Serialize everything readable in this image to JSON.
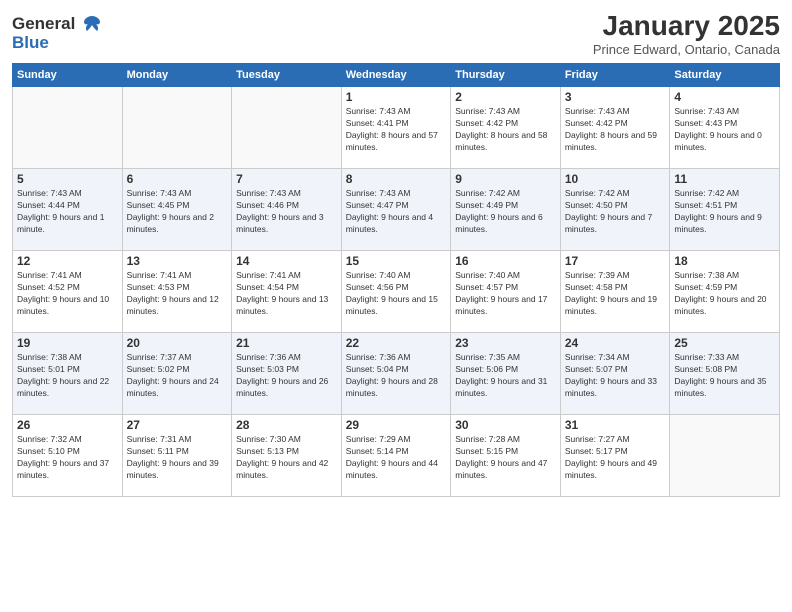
{
  "header": {
    "logo_line1": "General",
    "logo_line2": "Blue",
    "title": "January 2025",
    "location": "Prince Edward, Ontario, Canada"
  },
  "days_of_week": [
    "Sunday",
    "Monday",
    "Tuesday",
    "Wednesday",
    "Thursday",
    "Friday",
    "Saturday"
  ],
  "weeks": [
    [
      {
        "day": "",
        "text": ""
      },
      {
        "day": "",
        "text": ""
      },
      {
        "day": "",
        "text": ""
      },
      {
        "day": "1",
        "text": "Sunrise: 7:43 AM\nSunset: 4:41 PM\nDaylight: 8 hours and 57 minutes."
      },
      {
        "day": "2",
        "text": "Sunrise: 7:43 AM\nSunset: 4:42 PM\nDaylight: 8 hours and 58 minutes."
      },
      {
        "day": "3",
        "text": "Sunrise: 7:43 AM\nSunset: 4:42 PM\nDaylight: 8 hours and 59 minutes."
      },
      {
        "day": "4",
        "text": "Sunrise: 7:43 AM\nSunset: 4:43 PM\nDaylight: 9 hours and 0 minutes."
      }
    ],
    [
      {
        "day": "5",
        "text": "Sunrise: 7:43 AM\nSunset: 4:44 PM\nDaylight: 9 hours and 1 minute."
      },
      {
        "day": "6",
        "text": "Sunrise: 7:43 AM\nSunset: 4:45 PM\nDaylight: 9 hours and 2 minutes."
      },
      {
        "day": "7",
        "text": "Sunrise: 7:43 AM\nSunset: 4:46 PM\nDaylight: 9 hours and 3 minutes."
      },
      {
        "day": "8",
        "text": "Sunrise: 7:43 AM\nSunset: 4:47 PM\nDaylight: 9 hours and 4 minutes."
      },
      {
        "day": "9",
        "text": "Sunrise: 7:42 AM\nSunset: 4:49 PM\nDaylight: 9 hours and 6 minutes."
      },
      {
        "day": "10",
        "text": "Sunrise: 7:42 AM\nSunset: 4:50 PM\nDaylight: 9 hours and 7 minutes."
      },
      {
        "day": "11",
        "text": "Sunrise: 7:42 AM\nSunset: 4:51 PM\nDaylight: 9 hours and 9 minutes."
      }
    ],
    [
      {
        "day": "12",
        "text": "Sunrise: 7:41 AM\nSunset: 4:52 PM\nDaylight: 9 hours and 10 minutes."
      },
      {
        "day": "13",
        "text": "Sunrise: 7:41 AM\nSunset: 4:53 PM\nDaylight: 9 hours and 12 minutes."
      },
      {
        "day": "14",
        "text": "Sunrise: 7:41 AM\nSunset: 4:54 PM\nDaylight: 9 hours and 13 minutes."
      },
      {
        "day": "15",
        "text": "Sunrise: 7:40 AM\nSunset: 4:56 PM\nDaylight: 9 hours and 15 minutes."
      },
      {
        "day": "16",
        "text": "Sunrise: 7:40 AM\nSunset: 4:57 PM\nDaylight: 9 hours and 17 minutes."
      },
      {
        "day": "17",
        "text": "Sunrise: 7:39 AM\nSunset: 4:58 PM\nDaylight: 9 hours and 19 minutes."
      },
      {
        "day": "18",
        "text": "Sunrise: 7:38 AM\nSunset: 4:59 PM\nDaylight: 9 hours and 20 minutes."
      }
    ],
    [
      {
        "day": "19",
        "text": "Sunrise: 7:38 AM\nSunset: 5:01 PM\nDaylight: 9 hours and 22 minutes."
      },
      {
        "day": "20",
        "text": "Sunrise: 7:37 AM\nSunset: 5:02 PM\nDaylight: 9 hours and 24 minutes."
      },
      {
        "day": "21",
        "text": "Sunrise: 7:36 AM\nSunset: 5:03 PM\nDaylight: 9 hours and 26 minutes."
      },
      {
        "day": "22",
        "text": "Sunrise: 7:36 AM\nSunset: 5:04 PM\nDaylight: 9 hours and 28 minutes."
      },
      {
        "day": "23",
        "text": "Sunrise: 7:35 AM\nSunset: 5:06 PM\nDaylight: 9 hours and 31 minutes."
      },
      {
        "day": "24",
        "text": "Sunrise: 7:34 AM\nSunset: 5:07 PM\nDaylight: 9 hours and 33 minutes."
      },
      {
        "day": "25",
        "text": "Sunrise: 7:33 AM\nSunset: 5:08 PM\nDaylight: 9 hours and 35 minutes."
      }
    ],
    [
      {
        "day": "26",
        "text": "Sunrise: 7:32 AM\nSunset: 5:10 PM\nDaylight: 9 hours and 37 minutes."
      },
      {
        "day": "27",
        "text": "Sunrise: 7:31 AM\nSunset: 5:11 PM\nDaylight: 9 hours and 39 minutes."
      },
      {
        "day": "28",
        "text": "Sunrise: 7:30 AM\nSunset: 5:13 PM\nDaylight: 9 hours and 42 minutes."
      },
      {
        "day": "29",
        "text": "Sunrise: 7:29 AM\nSunset: 5:14 PM\nDaylight: 9 hours and 44 minutes."
      },
      {
        "day": "30",
        "text": "Sunrise: 7:28 AM\nSunset: 5:15 PM\nDaylight: 9 hours and 47 minutes."
      },
      {
        "day": "31",
        "text": "Sunrise: 7:27 AM\nSunset: 5:17 PM\nDaylight: 9 hours and 49 minutes."
      },
      {
        "day": "",
        "text": ""
      }
    ]
  ]
}
